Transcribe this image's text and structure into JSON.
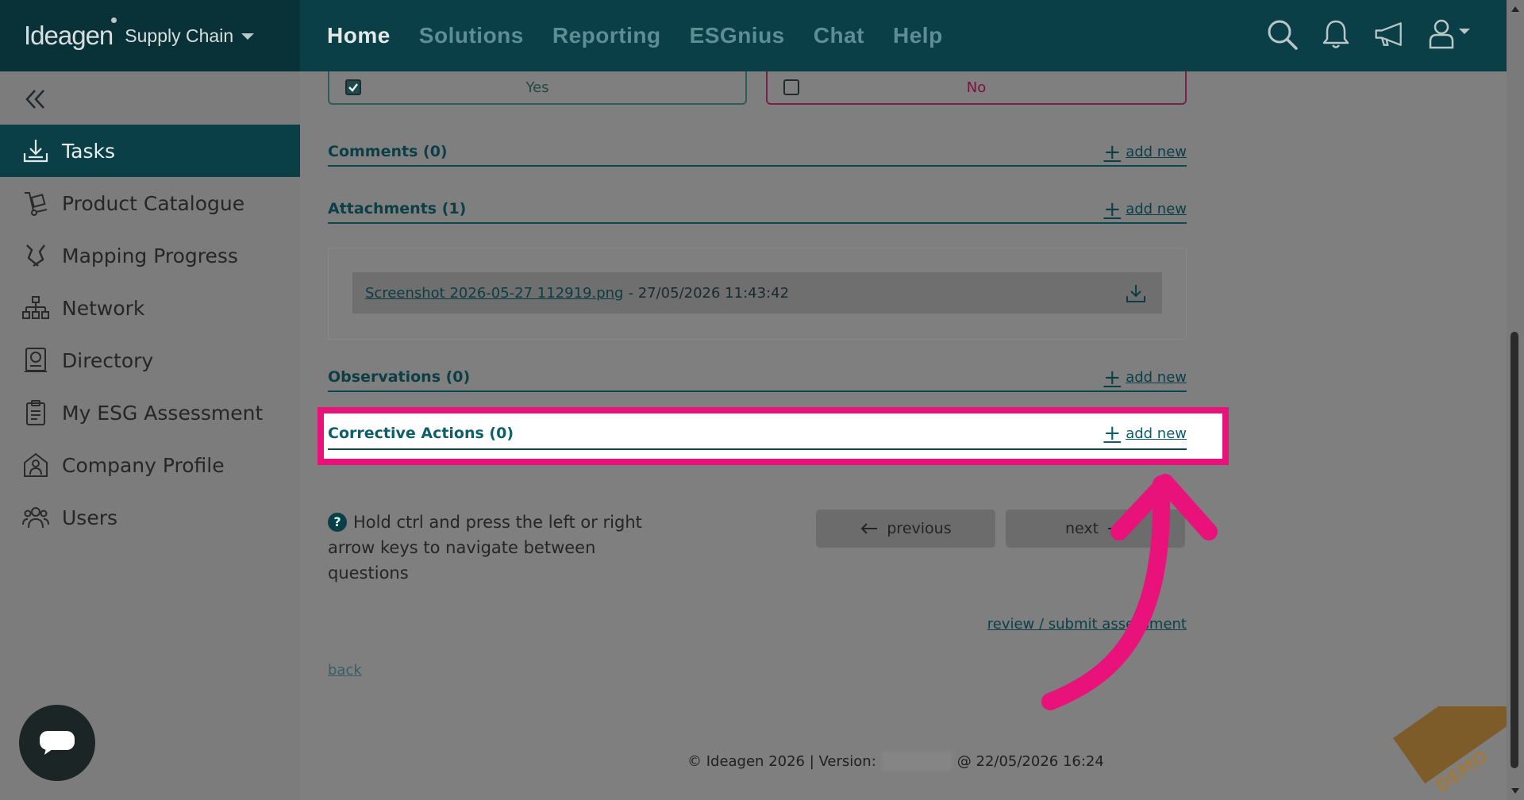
{
  "header": {
    "brand": "Ideagen",
    "brand_sub": "Supply Chain",
    "nav": [
      {
        "label": "Home",
        "active": true
      },
      {
        "label": "Solutions"
      },
      {
        "label": "Reporting"
      },
      {
        "label": "ESGnius"
      },
      {
        "label": "Chat"
      },
      {
        "label": "Help"
      }
    ],
    "icons": [
      "search-icon",
      "bell-icon",
      "megaphone-icon",
      "user-icon"
    ]
  },
  "sidebar": {
    "items": [
      {
        "label": "Tasks",
        "icon": "download-tray-icon",
        "active": true
      },
      {
        "label": "Product Catalogue",
        "icon": "hand-truck-icon"
      },
      {
        "label": "Mapping Progress",
        "icon": "route-icon"
      },
      {
        "label": "Network",
        "icon": "network-icon"
      },
      {
        "label": "Directory",
        "icon": "directory-icon"
      },
      {
        "label": "My ESG Assessment",
        "icon": "clipboard-icon"
      },
      {
        "label": "Company Profile",
        "icon": "building-icon"
      },
      {
        "label": "Users",
        "icon": "users-icon"
      }
    ]
  },
  "answer": {
    "yes_label": "Yes",
    "yes_checked": true,
    "no_label": "No",
    "no_checked": false
  },
  "sections": {
    "comments": "Comments (0)",
    "attachments": "Attachments (1)",
    "observations": "Observations (0)",
    "corrective_actions": "Corrective Actions (0)",
    "add_new": "add new"
  },
  "attachment": {
    "file_name": "Screenshot 2026-05-27 112919.png",
    "timestamp": "- 27/05/2026 11:43:42"
  },
  "navigation": {
    "hint": "Hold ctrl and press the left or right arrow keys to navigate between questions",
    "previous": "previous",
    "next": "next",
    "review": "review / submit assessment",
    "back": "back"
  },
  "footer": {
    "copyright": "© Ideagen 2026 | Version:",
    "date": "@ 22/05/2026 16:24"
  },
  "demo_badge": "DEMO",
  "colors": {
    "topbar": "#0a3f47",
    "highlight": "#e8127a",
    "accent": "#0f5f6a"
  }
}
